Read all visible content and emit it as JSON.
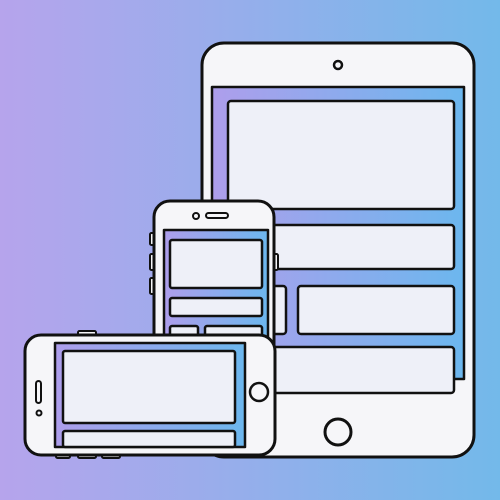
{
  "illustration": {
    "subject": "responsive-devices",
    "devices": [
      "tablet",
      "phone-portrait",
      "phone-landscape"
    ]
  },
  "colors": {
    "background_left": "#b6a4ec",
    "background_right": "#73b9ea",
    "screen_gradient_left": "#ae9eec",
    "screen_gradient_right": "#6cb7ee",
    "device_body": "#f6f6f9",
    "content_block": "#eef0f8",
    "outline": "#111111"
  }
}
